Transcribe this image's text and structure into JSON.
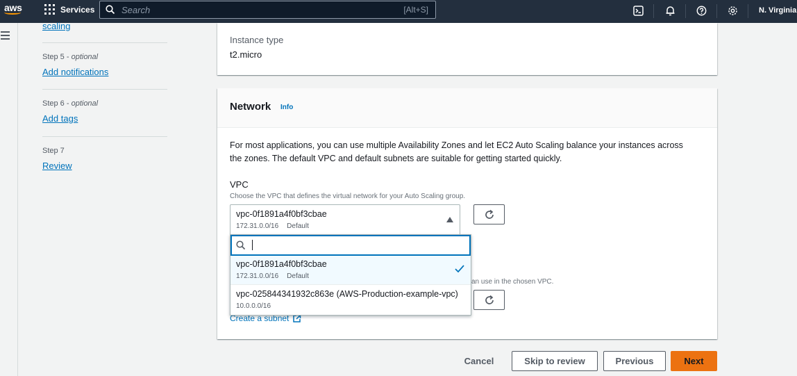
{
  "topnav": {
    "logo_text": "aws",
    "services_label": "Services",
    "search_placeholder": "Search",
    "search_shortcut": "[Alt+S]",
    "region": "N. Virginia"
  },
  "steps": [
    {
      "id": "scaling",
      "link": "scaling"
    },
    {
      "id": "step5",
      "label": "Step 5 - ",
      "optional": "optional",
      "link": "Add notifications"
    },
    {
      "id": "step6",
      "label": "Step 6 - ",
      "optional": "optional",
      "link": "Add tags"
    },
    {
      "id": "step7",
      "label": "Step 7",
      "link": "Review"
    }
  ],
  "instance": {
    "label": "Instance type",
    "value": "t2.micro"
  },
  "network": {
    "title": "Network",
    "info": "Info",
    "description_line1": "For most applications, you can use multiple Availability Zones and let EC2 Auto Scaling balance your instances across",
    "description_line2": "the zones. The default VPC and default subnets are suitable for getting started quickly.",
    "vpc_label": "VPC",
    "vpc_description": "Choose the VPC that defines the virtual network for your Auto Scaling group.",
    "selected": {
      "id": "vpc-0f1891a4f0bf3cbae",
      "cidr": "172.31.0.0/16",
      "tag": "Default"
    },
    "options": [
      {
        "id": "vpc-0f1891a4f0bf3cbae",
        "cidr": "172.31.0.0/16",
        "tag": "Default",
        "selected": true
      },
      {
        "id": "vpc-025844341932c863e (AWS-Production-example-vpc)",
        "cidr": "10.0.0.0/16",
        "tag": ""
      }
    ],
    "subnet_hint_partial": "an use in the chosen VPC.",
    "create_subnet": "Create a subnet"
  },
  "actions": {
    "cancel": "Cancel",
    "skip": "Skip to review",
    "previous": "Previous",
    "next": "Next"
  },
  "colors": {
    "nav_bg": "#232f3e",
    "link": "#0073bb",
    "primary": "#ec7211",
    "selected_bg": "#f1faff"
  }
}
